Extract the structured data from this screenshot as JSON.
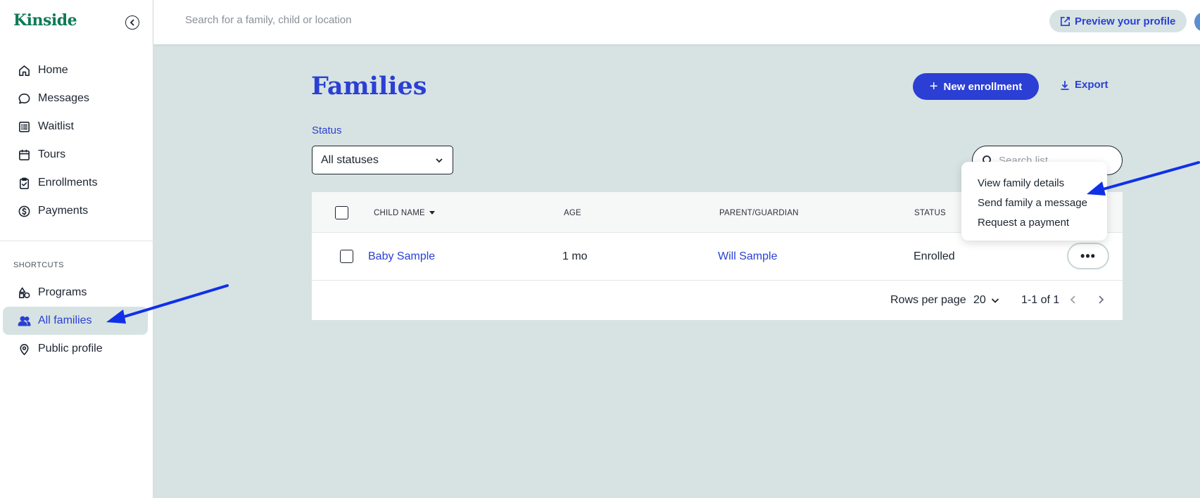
{
  "app": {
    "logo": "Kinside"
  },
  "topbar": {
    "search_placeholder": "Search for a family, child or location",
    "preview_label": "Preview your profile"
  },
  "sidebar": {
    "items": [
      {
        "label": "Home",
        "icon": "home-icon"
      },
      {
        "label": "Messages",
        "icon": "chat-icon"
      },
      {
        "label": "Waitlist",
        "icon": "list-icon"
      },
      {
        "label": "Tours",
        "icon": "calendar-icon"
      },
      {
        "label": "Enrollments",
        "icon": "clipboard-icon"
      },
      {
        "label": "Payments",
        "icon": "dollar-icon"
      }
    ],
    "shortcuts_label": "SHORTCUTS",
    "shortcuts": [
      {
        "label": "Programs",
        "icon": "shapes-icon"
      },
      {
        "label": "All families",
        "icon": "users-icon",
        "active": true
      },
      {
        "label": "Public profile",
        "icon": "location-pin-icon"
      }
    ]
  },
  "main": {
    "title": "Families",
    "new_enrollment_label": "New enrollment",
    "export_label": "Export",
    "status_label": "Status",
    "status_value": "All statuses",
    "search_placeholder": "Search list"
  },
  "table": {
    "columns": [
      "CHILD NAME",
      "AGE",
      "PARENT/GUARDIAN",
      "STATUS"
    ],
    "rows": [
      {
        "child": "Baby Sample",
        "age": "1 mo",
        "parent": "Will Sample",
        "status": "Enrolled"
      }
    ],
    "more_label": "•••"
  },
  "pagination": {
    "rows_per_page_label": "Rows per page",
    "rows_per_page": "20",
    "range": "1-1 of 1"
  },
  "menu": {
    "items": [
      "View family details",
      "Send family a message",
      "Request a payment"
    ]
  },
  "colors": {
    "accent": "#2b3fd4",
    "brand": "#0f7a55",
    "background": "#d6e3e2",
    "annotation_arrow": "#1030e8"
  }
}
